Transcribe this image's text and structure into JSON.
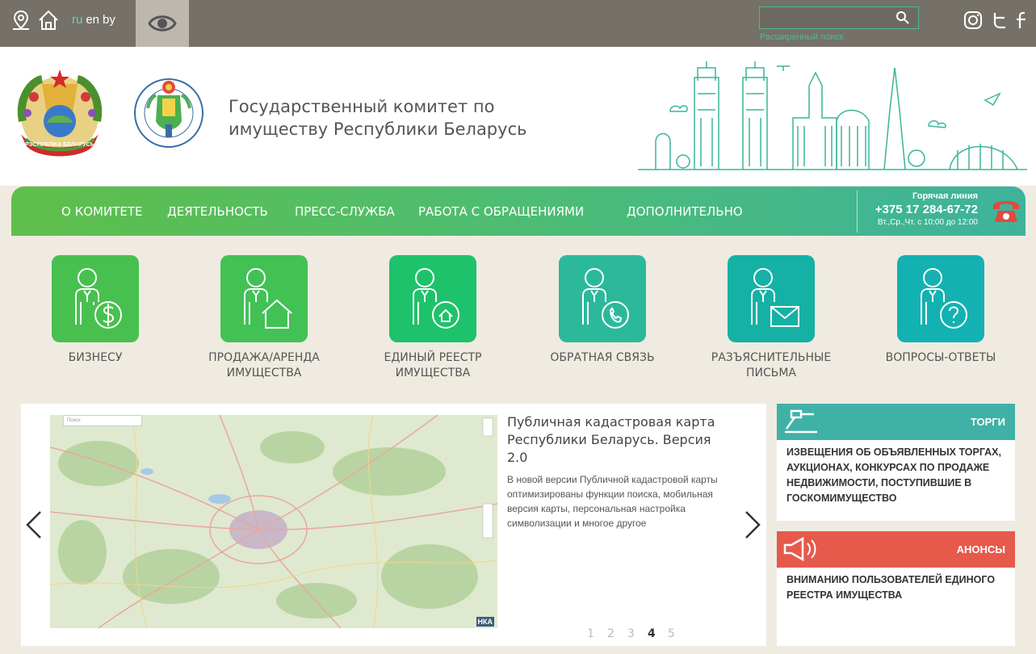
{
  "topbar": {
    "languages": [
      {
        "code": "ru",
        "active": true
      },
      {
        "code": "en",
        "active": false
      },
      {
        "code": "by",
        "active": false
      }
    ],
    "search_placeholder": "",
    "advanced_search_label": "Расширенный поиск"
  },
  "header": {
    "title": "Государственный комитет по имуществу Республики Беларусь",
    "emblem_text": "РЭСПУБЛІКА БЕЛАРУСЬ"
  },
  "nav": {
    "items": [
      {
        "label": "О КОМИТЕТЕ"
      },
      {
        "label": "ДЕЯТЕЛЬНОСТЬ"
      },
      {
        "label": "ПРЕСС-СЛУЖБА"
      },
      {
        "label": "РАБОТА С ОБРАЩЕНИЯМИ"
      },
      {
        "label": "ДОПОЛНИТЕЛЬНО"
      }
    ],
    "hotline": {
      "label": "Горячая линия",
      "phone": "+375 17 284-67-72",
      "hours": "Вт.,Ср.,Чт. с 10:00 до 12:00"
    }
  },
  "tiles": [
    {
      "label": "БИЗНЕСУ",
      "icon": "person-dollar-icon",
      "color": "#48c04f"
    },
    {
      "label": "ПРОДАЖА/АРЕНДА ИМУЩЕСТВА",
      "icon": "person-house-icon",
      "color": "#42c155"
    },
    {
      "label": "ЕДИНЫЙ РЕЕСТР ИМУЩЕСТВА",
      "icon": "person-registry-icon",
      "color": "#1ec26a"
    },
    {
      "label": "ОБРАТНАЯ СВЯЗЬ",
      "icon": "person-phone-icon",
      "color": "#2cb99b"
    },
    {
      "label": "РАЗЪЯСНИТЕЛЬНЫЕ ПИСЬМА",
      "icon": "person-letter-icon",
      "color": "#15b1a4"
    },
    {
      "label": "ВОПРОСЫ-ОТВЕТЫ",
      "icon": "person-question-icon",
      "color": "#13b1b1"
    }
  ],
  "slider": {
    "title": "Публичная кадастровая карта Республики Беларусь. Версия 2.0",
    "text": "В новой версии Публичной кадастровой карты оптимизированы функции поиска, мобильная версия карты, персональная настройка символизации и многое другое",
    "map_search_placeholder": "Поиск",
    "map_logo": "НКА",
    "pages": [
      "1",
      "2",
      "3",
      "4",
      "5"
    ],
    "active_page": "4"
  },
  "cards": {
    "torgi": {
      "title": "ТОРГИ",
      "color": "#3fb1a6",
      "text": "ИЗВЕЩЕНИЯ ОБ ОБЪЯВЛЕННЫХ ТОРГАХ, АУКЦИОНАХ, КОНКУРСАХ ПО ПРОДАЖЕ НЕДВИЖИМОСТИ, ПОСТУПИВШИЕ В ГОСКОМИМУЩЕСТВО"
    },
    "anonsy": {
      "title": "АНОНСЫ",
      "color": "#e65a4c",
      "text": "ВНИМАНИЮ ПОЛЬЗОВАТЕЛЕЙ ЕДИНОГО РЕЕСТРА ИМУЩЕСТВА"
    }
  }
}
